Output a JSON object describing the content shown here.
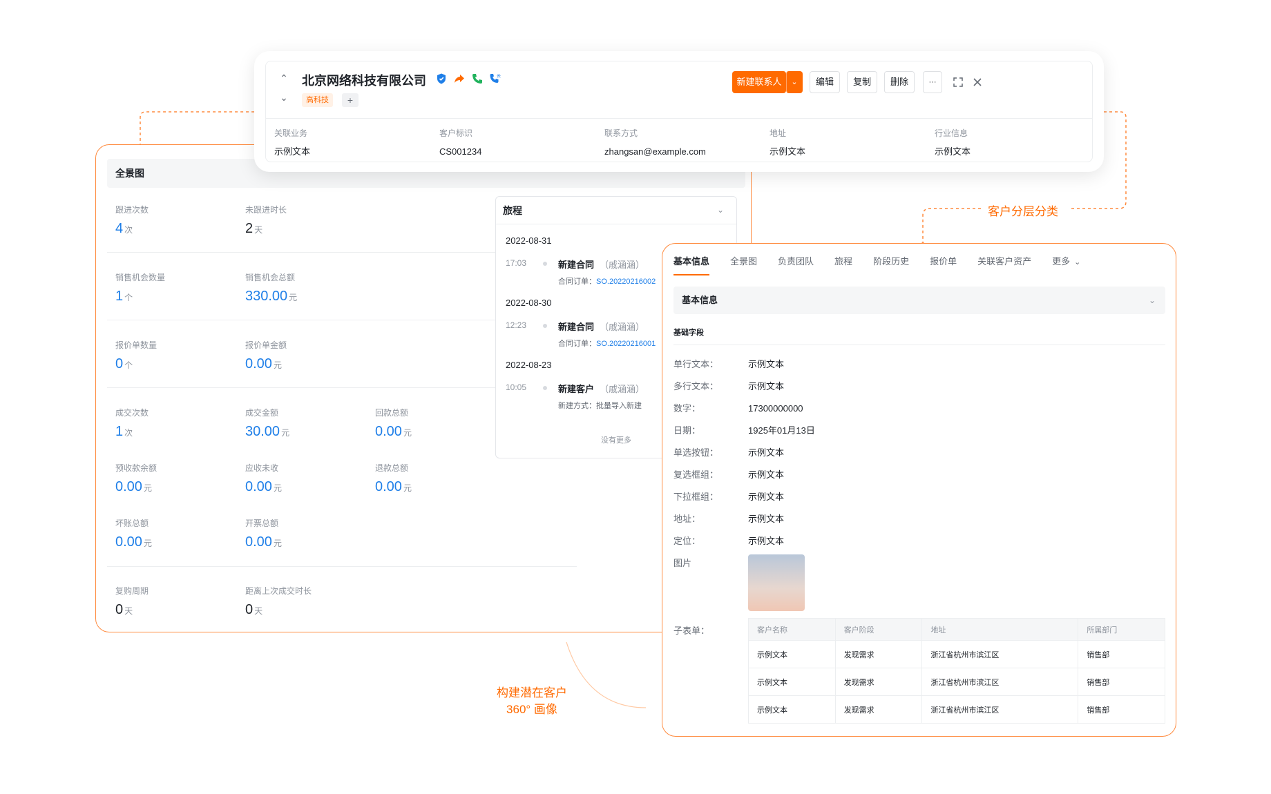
{
  "header": {
    "company_name": "北京网络科技有限公司",
    "tag": "高科技",
    "add_tag": "+",
    "buttons": {
      "new_contact": "新建联系人",
      "edit": "编辑",
      "copy": "复制",
      "delete": "删除",
      "more": "···"
    },
    "fields": [
      {
        "label": "关联业务",
        "value": "示例文本"
      },
      {
        "label": "客户标识",
        "value": "CS001234"
      },
      {
        "label": "联系方式",
        "value": "zhangsan@example.com"
      },
      {
        "label": "地址",
        "value": "示例文本"
      },
      {
        "label": "行业信息",
        "value": "示例文本"
      }
    ]
  },
  "panorama": {
    "title": "全景图",
    "metrics": {
      "follow_count": {
        "label": "跟进次数",
        "value": "4",
        "unit": "次"
      },
      "no_follow_duration": {
        "label": "未跟进时长",
        "value": "2",
        "unit": "天"
      },
      "opp_count": {
        "label": "销售机会数量",
        "value": "1",
        "unit": "个"
      },
      "opp_amount": {
        "label": "销售机会总额",
        "value": "330.00",
        "unit": "元"
      },
      "quote_count": {
        "label": "报价单数量",
        "value": "0",
        "unit": "个"
      },
      "quote_amount": {
        "label": "报价单金额",
        "value": "0.00",
        "unit": "元"
      },
      "deal_count": {
        "label": "成交次数",
        "value": "1",
        "unit": "次"
      },
      "deal_amount": {
        "label": "成交金额",
        "value": "30.00",
        "unit": "元"
      },
      "payback_total": {
        "label": "回款总额",
        "value": "0.00",
        "unit": "元"
      },
      "prepay_balance": {
        "label": "预收款余额",
        "value": "0.00",
        "unit": "元"
      },
      "receivable": {
        "label": "应收未收",
        "value": "0.00",
        "unit": "元"
      },
      "refund_total": {
        "label": "退款总额",
        "value": "0.00",
        "unit": "元"
      },
      "bad_debt": {
        "label": "坏账总额",
        "value": "0.00",
        "unit": "元"
      },
      "invoice_total": {
        "label": "开票总额",
        "value": "0.00",
        "unit": "元"
      },
      "repurchase_cycle": {
        "label": "复购周期",
        "value": "0",
        "unit": "天"
      },
      "since_last_deal": {
        "label": "距离上次成交时长",
        "value": "0",
        "unit": "天"
      }
    }
  },
  "journey": {
    "title": "旅程",
    "groups": [
      {
        "date": "2022-08-31",
        "time": "17:03",
        "title": "新建合同",
        "who": "（戚涵涵）",
        "sub_label": "合同订单：",
        "sub_value": "SO.20220216002"
      },
      {
        "date": "2022-08-30",
        "time": "12:23",
        "title": "新建合同",
        "who": "（戚涵涵）",
        "sub_label": "合同订单：",
        "sub_value": "SO.20220216001"
      },
      {
        "date": "2022-08-23",
        "time": "10:05",
        "title": "新建客户",
        "who": "（戚涵涵）",
        "sub_label": "新建方式：",
        "sub_value": "批量导入新建"
      }
    ],
    "no_more": "没有更多"
  },
  "detail": {
    "tabs": [
      "基本信息",
      "全景图",
      "负责团队",
      "旅程",
      "阶段历史",
      "报价单",
      "关联客户资产",
      "更多"
    ],
    "section_title": "基本信息",
    "sub_section": "基础字段",
    "fields": [
      {
        "label": "单行文本：",
        "value": "示例文本"
      },
      {
        "label": "多行文本：",
        "value": "示例文本"
      },
      {
        "label": "数字：",
        "value": "17300000000"
      },
      {
        "label": "日期：",
        "value": "1925年01月13日"
      },
      {
        "label": "单选按钮：",
        "value": "示例文本"
      },
      {
        "label": "复选框组：",
        "value": "示例文本"
      },
      {
        "label": "下拉框组：",
        "value": "示例文本"
      },
      {
        "label": "地址：",
        "value": "示例文本"
      },
      {
        "label": "定位：",
        "value": "示例文本"
      }
    ],
    "image_label": "图片",
    "subtable_label": "子表单：",
    "subtable": {
      "headers": [
        "客户名称",
        "客户阶段",
        "地址",
        "所属部门"
      ],
      "rows": [
        [
          "示例文本",
          "发现需求",
          "浙江省杭州市滨江区",
          "销售部"
        ],
        [
          "示例文本",
          "发现需求",
          "浙江省杭州市滨江区",
          "销售部"
        ],
        [
          "示例文本",
          "发现需求",
          "浙江省杭州市滨江区",
          "销售部"
        ]
      ]
    }
  },
  "callouts": {
    "layering": "客户分层分类",
    "portrait_line1": "构建潜在客户",
    "portrait_line2": "360° 画像"
  },
  "colors": {
    "accent": "#ff6a00",
    "link": "#1f7fe8"
  }
}
